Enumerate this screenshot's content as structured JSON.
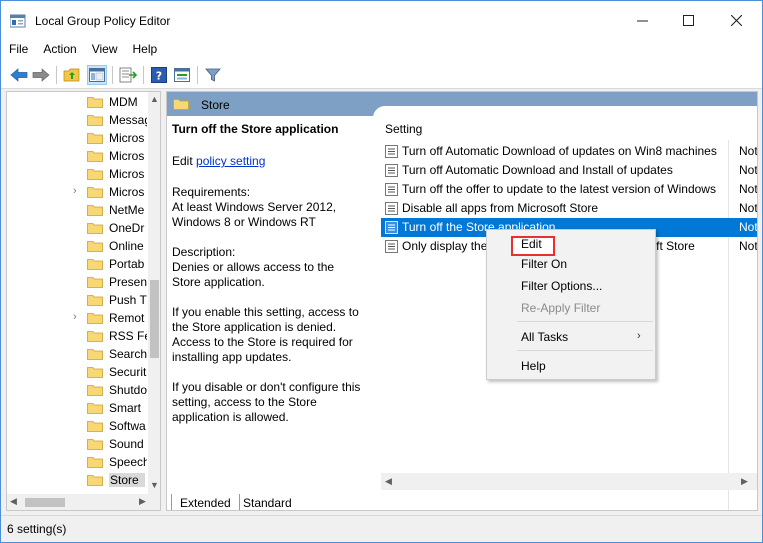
{
  "window": {
    "title": "Local Group Policy Editor",
    "controls": {
      "minimize": "—",
      "maximize": "☐",
      "close": "✕"
    }
  },
  "menu": [
    "File",
    "Action",
    "View",
    "Help"
  ],
  "toolbar": {
    "icons": [
      "back-arrow-icon",
      "forward-arrow-icon",
      "up-folder-icon",
      "show-hide-tree-icon",
      "export-list-icon",
      "help-icon",
      "properties-icon",
      "filter-icon"
    ]
  },
  "tree": {
    "items": [
      {
        "label": "MDM",
        "expander": ""
      },
      {
        "label": "Messag",
        "expander": ""
      },
      {
        "label": "Micros",
        "expander": ""
      },
      {
        "label": "Micros",
        "expander": ""
      },
      {
        "label": "Micros",
        "expander": ""
      },
      {
        "label": "Micros",
        "expander": "›"
      },
      {
        "label": "NetMe",
        "expander": ""
      },
      {
        "label": "OneDr",
        "expander": ""
      },
      {
        "label": "Online",
        "expander": ""
      },
      {
        "label": "Portab",
        "expander": ""
      },
      {
        "label": "Presen",
        "expander": ""
      },
      {
        "label": "Push T",
        "expander": ""
      },
      {
        "label": "Remot",
        "expander": "›"
      },
      {
        "label": "RSS Fe",
        "expander": ""
      },
      {
        "label": "Search",
        "expander": ""
      },
      {
        "label": "Securit",
        "expander": ""
      },
      {
        "label": "Shutdo",
        "expander": ""
      },
      {
        "label": "Smart",
        "expander": ""
      },
      {
        "label": "Softwa",
        "expander": ""
      },
      {
        "label": "Sound",
        "expander": ""
      },
      {
        "label": "Speech",
        "expander": ""
      },
      {
        "label": "Store",
        "expander": "",
        "selected": true
      }
    ]
  },
  "right": {
    "header_title": "Store",
    "description": {
      "policy_title": "Turn off the Store application",
      "edit_prefix": "Edit ",
      "edit_link": "policy setting",
      "requirements_label": "Requirements:",
      "requirements_text": "At least Windows Server 2012, Windows 8 or Windows RT",
      "description_label": "Description:",
      "description_text": "Denies or allows access to the Store application.",
      "enable_text": "If you enable this setting, access to the Store application is denied. Access to the Store is required for installing app updates.",
      "disable_text": "If you disable or don't configure this setting, access to the Store application is allowed."
    },
    "list": {
      "column_setting": "Setting",
      "rows": [
        {
          "name": "Turn off Automatic Download of updates on Win8 machines",
          "state": "Not"
        },
        {
          "name": "Turn off Automatic Download and Install of updates",
          "state": "Not"
        },
        {
          "name": "Turn off the offer to update to the latest version of Windows",
          "state": "Not"
        },
        {
          "name": "Disable all apps from Microsoft Store",
          "state": "Not"
        },
        {
          "name": "Turn off the Store application",
          "state": "Not",
          "selected": true
        },
        {
          "name": "Only display the private store within the Microsoft Store",
          "state": "Not"
        }
      ]
    },
    "tabs": [
      "Extended",
      "Standard"
    ]
  },
  "context_menu": {
    "items": [
      {
        "label": "Edit",
        "highlighted": true
      },
      {
        "label": "Filter On"
      },
      {
        "label": "Filter Options..."
      },
      {
        "label": "Re-Apply Filter",
        "disabled": true
      },
      {
        "label": "All Tasks",
        "submenu": true
      },
      {
        "label": "Help"
      }
    ]
  },
  "status": {
    "text": "6 setting(s)"
  },
  "colors": {
    "selection": "#0078d7",
    "header_band": "#7da0c4",
    "edit_outline": "#e8312f",
    "link": "#0033cc"
  }
}
